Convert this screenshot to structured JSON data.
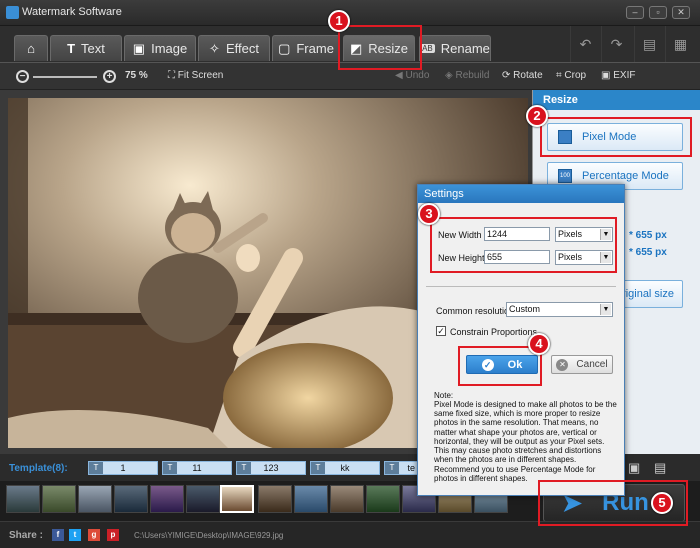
{
  "window": {
    "title": "Watermark Software"
  },
  "tabs": [
    {
      "label": "",
      "icon": "home-icon"
    },
    {
      "label": "Text",
      "icon": "text-icon"
    },
    {
      "label": "Image",
      "icon": "image-icon"
    },
    {
      "label": "Effect",
      "icon": "effect-icon"
    },
    {
      "label": "Frame",
      "icon": "frame-icon"
    },
    {
      "label": "Resize",
      "icon": "resize-icon"
    },
    {
      "label": "Rename",
      "icon": "rename-icon"
    }
  ],
  "toolbar": {
    "zoom": "75 %",
    "fit_screen": "Fit Screen",
    "undo": "Undo",
    "rebuild": "Rebuild",
    "rotate": "Rotate",
    "crop": "Crop",
    "exif": "EXIF"
  },
  "panel": {
    "header": "Resize",
    "pixel_mode": "Pixel Mode",
    "percentage_mode": "Percentage Mode",
    "size_line_1": "* 655 px",
    "size_line_2": "* 655 px",
    "original_size": "riginal size"
  },
  "dialog": {
    "title": "Settings",
    "new_width_label": "New Width :",
    "new_width_value": "1244",
    "new_height_label": "New Height :",
    "new_height_value": "655",
    "unit": "Pixels",
    "common_resolution_label": "Common resolution :",
    "common_resolution_value": "Custom",
    "constrain_label": "Constrain Proportions",
    "ok": "Ok",
    "cancel": "Cancel",
    "note_title": "Note:",
    "note_body": "Pixel Mode is designed to make all photos to be the same fixed size, which is more proper to resize photos in the same resolution. That means, no matter what shape your photos are, vertical or horizontal, they will be output as your Pixel sets. This may cause photo stretches and distortions when the photos are in different shapes.",
    "note_extra": "Recommend you to use Percentage Mode for photos in different shapes."
  },
  "templates": {
    "label": "Template(8):",
    "items": [
      "1",
      "11",
      "123",
      "kk",
      "te"
    ]
  },
  "run": {
    "label": "Run"
  },
  "status": {
    "share_label": "Share :",
    "path": "C:\\Users\\YIMIGE\\Desktop\\IMAGE\\929.jpg"
  },
  "callouts": [
    "1",
    "2",
    "3",
    "4",
    "5"
  ]
}
